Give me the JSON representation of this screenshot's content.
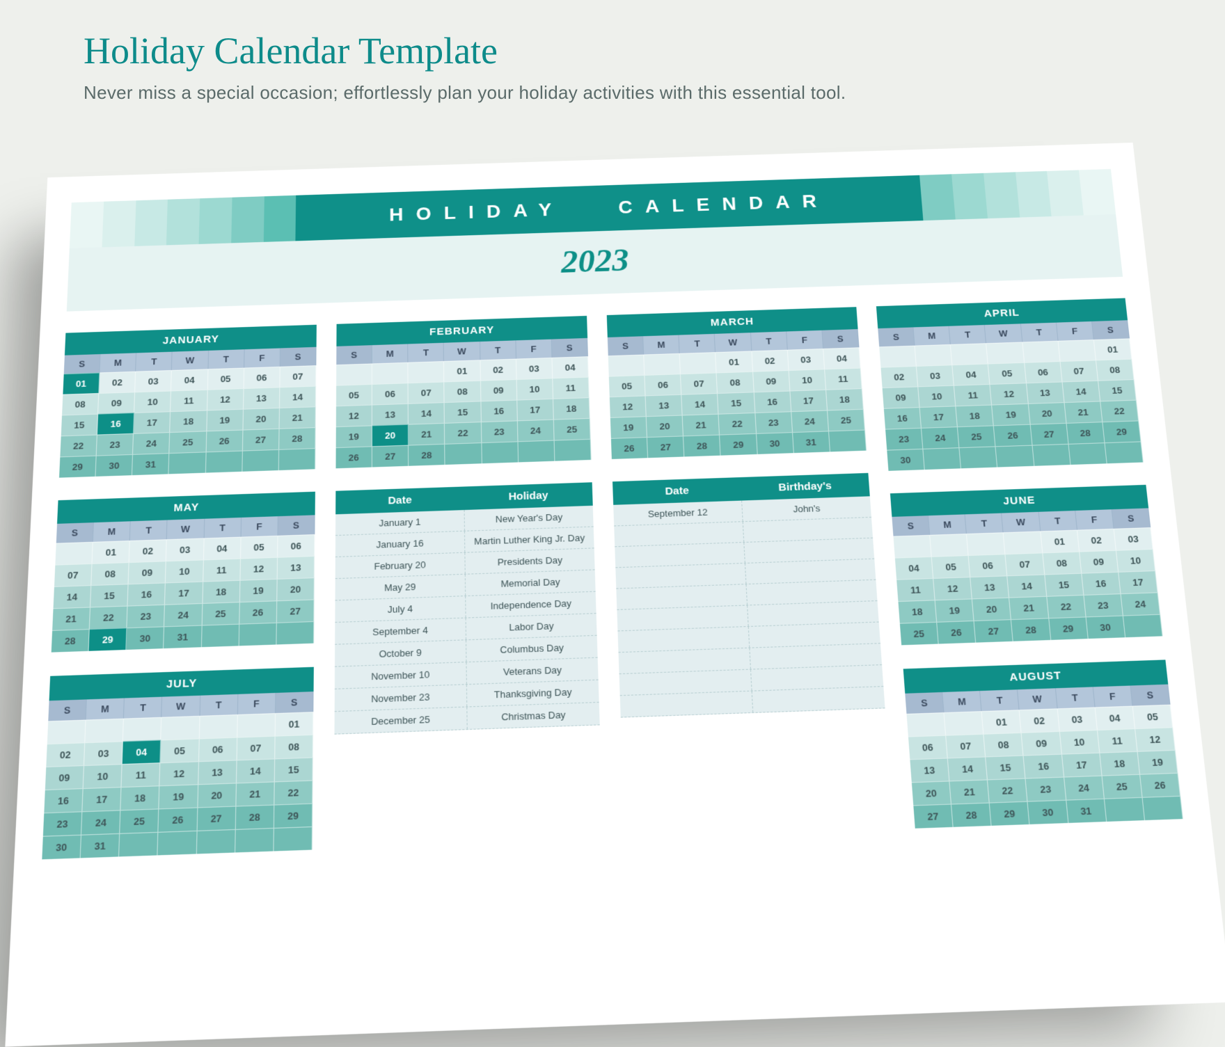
{
  "page": {
    "title": "Holiday Calendar Template",
    "subtitle": "Never miss a special occasion; effortlessly plan your holiday activities with this essential tool."
  },
  "banner": {
    "label1": "HOLIDAY",
    "label2": "CALENDAR"
  },
  "year": "2023",
  "dow": [
    "S",
    "M",
    "T",
    "W",
    "T",
    "F",
    "S"
  ],
  "months": {
    "jan": {
      "name": "JANUARY",
      "start": 0,
      "days": 31,
      "highlight": [
        1,
        16
      ]
    },
    "feb": {
      "name": "FEBRUARY",
      "start": 3,
      "days": 28,
      "highlight": [
        20
      ]
    },
    "mar": {
      "name": "MARCH",
      "start": 3,
      "days": 31,
      "highlight": []
    },
    "apr": {
      "name": "APRIL",
      "start": 6,
      "days": 30,
      "highlight": []
    },
    "may": {
      "name": "MAY",
      "start": 1,
      "days": 31,
      "highlight": [
        29
      ]
    },
    "jun": {
      "name": "JUNE",
      "start": 4,
      "days": 30,
      "highlight": []
    },
    "jul": {
      "name": "JULY",
      "start": 6,
      "days": 31,
      "highlight": [
        4
      ]
    },
    "aug": {
      "name": "AUGUST",
      "start": 2,
      "days": 31,
      "highlight": []
    }
  },
  "holidayTable": {
    "headers": [
      "Date",
      "Holiday"
    ],
    "rows": [
      [
        "January 1",
        "New Year's Day"
      ],
      [
        "January 16",
        "Martin Luther King Jr. Day"
      ],
      [
        "February 20",
        "Presidents Day"
      ],
      [
        "May 29",
        "Memorial Day"
      ],
      [
        "July 4",
        "Independence Day"
      ],
      [
        "September 4",
        "Labor Day"
      ],
      [
        "October 9",
        "Columbus Day"
      ],
      [
        "November 10",
        "Veterans Day"
      ],
      [
        "November 23",
        "Thanksgiving Day"
      ],
      [
        "December 25",
        "Christmas Day"
      ]
    ]
  },
  "birthdayTable": {
    "headers": [
      "Date",
      "Birthday's"
    ],
    "rows": [
      [
        "September 12",
        "John's"
      ]
    ],
    "emptyRows": 9
  }
}
